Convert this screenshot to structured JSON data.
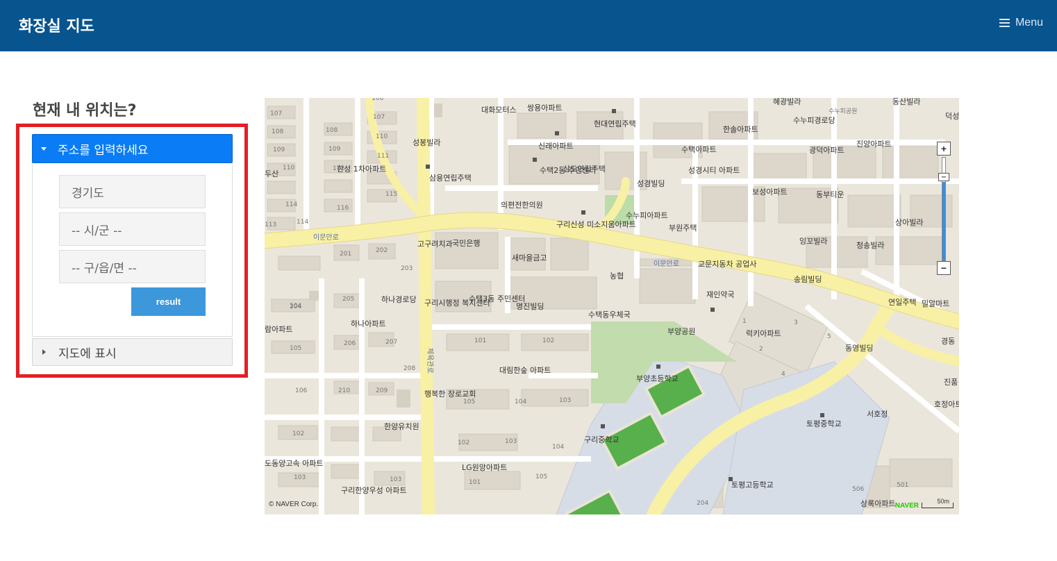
{
  "navbar": {
    "brand": "화장실 지도",
    "menu_label": "Menu"
  },
  "search_panel": {
    "heading": "현재 내 위치는?",
    "address_panel_title": "주소를 입력하세요",
    "province_value": "경기도",
    "city_placeholder": "-- 시/군 --",
    "district_placeholder": "-- 구/읍/면 --",
    "result_button": "result",
    "map_panel_title": "지도에 표시"
  },
  "map": {
    "copyright": "© NAVER Corp.",
    "logo": "NAVER",
    "scale_label": "50m",
    "zoom_in": "+",
    "zoom_out": "−",
    "labels": [
      "대화모터스",
      "쌍용아파트",
      "현대연립주택",
      "혜광빌라",
      "수누피공원",
      "동산빌라",
      "덕성",
      "한솔아파트",
      "수누피경로당",
      "성봉빌라",
      "신래아파트",
      "수택아파트",
      "광덕아파트",
      "진양아파트",
      "두산",
      "한성 1차아파트",
      "삼용연립주택",
      "수택2동 주민센터",
      "삼도연립주택",
      "성경빌딩",
      "성경시티 아파트",
      "보성아파트",
      "동부티운",
      "의편전한의원",
      "수누피아파트",
      "부원주택",
      "구리신성 미소지움아파트",
      "상아빌라",
      "고구려치과",
      "국민은행",
      "잉꼬빌라",
      "청송빌라",
      "새마을금고",
      "교문지동차 공업사",
      "송림빌딩",
      "농협",
      "하나경로당",
      "구리시행정 복지센터",
      "수택3동 주민센터",
      "명진빌딩",
      "재인약국",
      "연일주택",
      "밀알마트",
      "수택동우체국",
      "람아파트",
      "하나아파트",
      "부양공원",
      "럭키아파트",
      "동영빌딩",
      "경동",
      "대림한숲 아파트",
      "부양초등학교",
      "진품",
      "호정아트",
      "행복한 장로교회",
      "서호정",
      "한양유치원",
      "토평중학교",
      "구리중학교",
      "도동양고속 아파트",
      "LG원앙아파트",
      "구리한양우성 아파트",
      "토평고등학교",
      "상록아파트"
    ],
    "road_labels": [
      "이문안로",
      "이문안로",
      "체육관로"
    ],
    "building_numbers": [
      "107",
      "107",
      "108",
      "108",
      "109",
      "109",
      "110",
      "110",
      "111",
      "112",
      "113",
      "114",
      "114",
      "115",
      "116",
      "106",
      "201",
      "202",
      "203",
      "204",
      "205",
      "206",
      "207",
      "208",
      "209",
      "210",
      "104",
      "105",
      "106",
      "102",
      "103",
      "103",
      "101",
      "102",
      "103",
      "104",
      "105",
      "102",
      "103",
      "101",
      "104",
      "105",
      "1",
      "2",
      "3",
      "4",
      "5",
      "506",
      "501",
      "204"
    ]
  }
}
